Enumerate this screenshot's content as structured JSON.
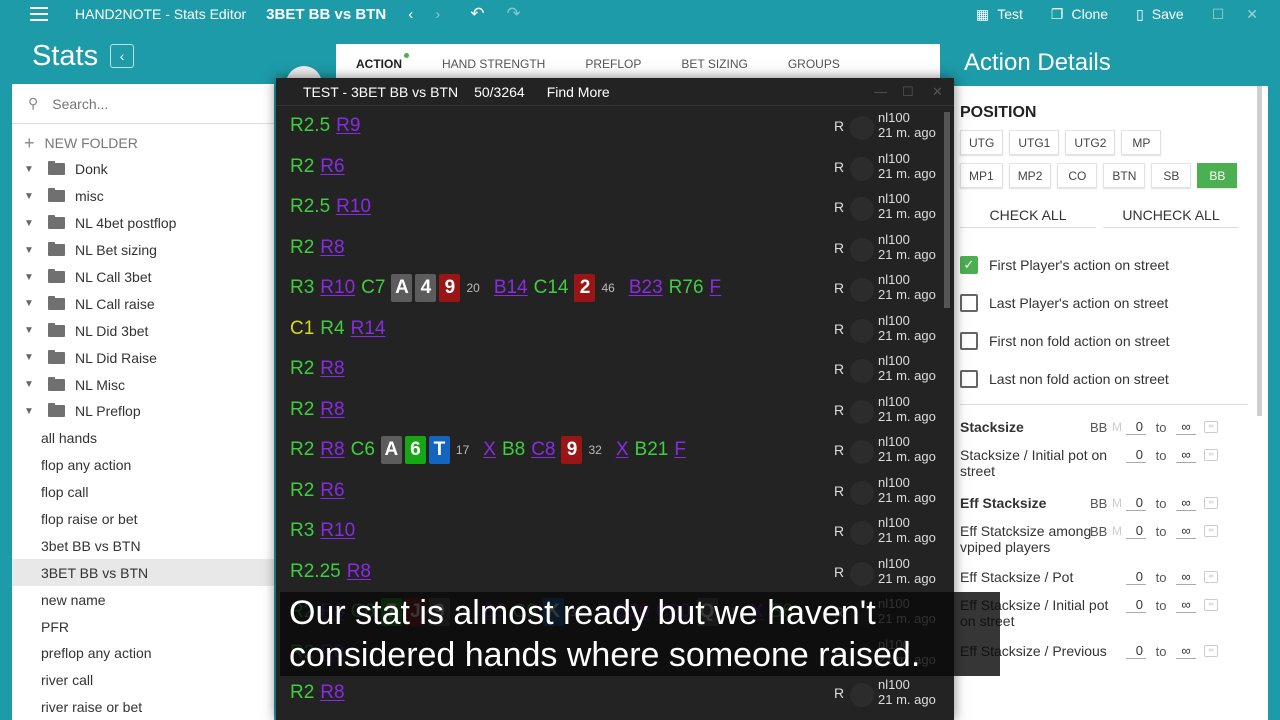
{
  "topbar": {
    "app_title": "HAND2NOTE - Stats Editor",
    "stat_title": "3BET BB vs BTN",
    "test_label": "Test",
    "clone_label": "Clone",
    "save_label": "Save"
  },
  "left": {
    "title": "Stats",
    "search_placeholder": "Search...",
    "new_folder_label": "NEW FOLDER",
    "folders": [
      "Donk",
      "misc",
      "NL 4bet postflop",
      "NL Bet sizing",
      "NL Call 3bet",
      "NL Call raise",
      "NL Did 3bet",
      "NL Did Raise",
      "NL Misc",
      "NL Preflop"
    ],
    "stats": [
      "all hands",
      "flop any action",
      "flop call",
      "flop raise or bet",
      "3bet BB vs BTN",
      "3BET BB vs BTN",
      "new name",
      "PFR",
      "preflop any action",
      "river call",
      "river raise or bet"
    ],
    "selected_stat": "3BET BB vs BTN"
  },
  "tabs": [
    "ACTION",
    "HAND STRENGTH",
    "PREFLOP",
    "BET SIZING",
    "GROUPS"
  ],
  "dialog": {
    "title": "TEST - 3BET BB vs BTN",
    "count": "50/3264",
    "find_more": "Find More",
    "r_label": "R",
    "meta_line1": "nl100",
    "meta_line2": "21 m. ago",
    "rows": [
      [
        "R2.5",
        "R9"
      ],
      [
        "R2",
        "R6"
      ],
      [
        "R2.5",
        "R10"
      ],
      [
        "R2",
        "R8"
      ],
      [
        "R3",
        "R10",
        "C7",
        "A",
        "4",
        "9",
        "20",
        "B14",
        "C14",
        "2",
        "46",
        "B23",
        "R76",
        "F"
      ],
      [
        "C1",
        "R4",
        "R14"
      ],
      [
        "R2",
        "R8"
      ],
      [
        "R2",
        "R8"
      ],
      [
        "R2",
        "R8",
        "C6",
        "A",
        "6",
        "T",
        "17",
        "X",
        "B8",
        "C8",
        "9",
        "32",
        "X",
        "B21",
        "F"
      ],
      [
        "R2",
        "R6"
      ],
      [
        "R3",
        "R10"
      ],
      [
        "R2.25",
        "R8"
      ],
      [
        "R2",
        "R8",
        "C6",
        "7",
        "J",
        "9",
        "16",
        "B9",
        "C9",
        "K",
        "33",
        "X",
        "B20",
        "C20",
        "Q",
        "71",
        "X",
        "B6"
      ],
      [
        "R2",
        "R8"
      ],
      [
        "R2",
        "R8"
      ]
    ]
  },
  "right": {
    "title": "Action Details",
    "position_title": "POSITION",
    "positions_row1": [
      "UTG",
      "UTG1",
      "UTG2",
      "MP"
    ],
    "positions_row2": [
      "MP1",
      "MP2",
      "CO",
      "BTN",
      "SB",
      "BB"
    ],
    "active_position": "BB",
    "check_all": "CHECK ALL",
    "uncheck_all": "UNCHECK ALL",
    "checkboxes": [
      {
        "label": "First Player's action on street",
        "checked": true
      },
      {
        "label": "Last Player's action on street",
        "checked": false
      },
      {
        "label": "First non fold action on street",
        "checked": false
      },
      {
        "label": "Last non fold action on street",
        "checked": false
      }
    ],
    "bb_label": "BB",
    "m_label": "M",
    "zero": "0",
    "to_label": "to",
    "inf_label": "∞",
    "stacks": [
      {
        "label": "Stacksize",
        "bold": true,
        "bb": true
      },
      {
        "label": "Stacksize / Initial pot on street",
        "bold": false,
        "bb": false
      },
      {
        "label": "Eff Stacksize",
        "bold": true,
        "bb": true
      },
      {
        "label": "Eff Statcksize among vpiped players",
        "bold": false,
        "bb": true
      },
      {
        "label": "Eff Stacksize / Pot",
        "bold": false,
        "bb": false
      },
      {
        "label": "Eff Stacksize / Initial pot on street",
        "bold": false,
        "bb": false
      },
      {
        "label": "Eff Stacksize / Previous",
        "bold": false,
        "bb": false
      }
    ]
  },
  "subtitle": {
    "line1": "Our stat is almost ready but we haven't",
    "line2": "considered hands where someone raised."
  },
  "colors": {
    "teal": "#1d9ba8",
    "green_action": "#3ecf3e",
    "purple_action": "#8a2be2",
    "active_button": "#4caf50"
  }
}
